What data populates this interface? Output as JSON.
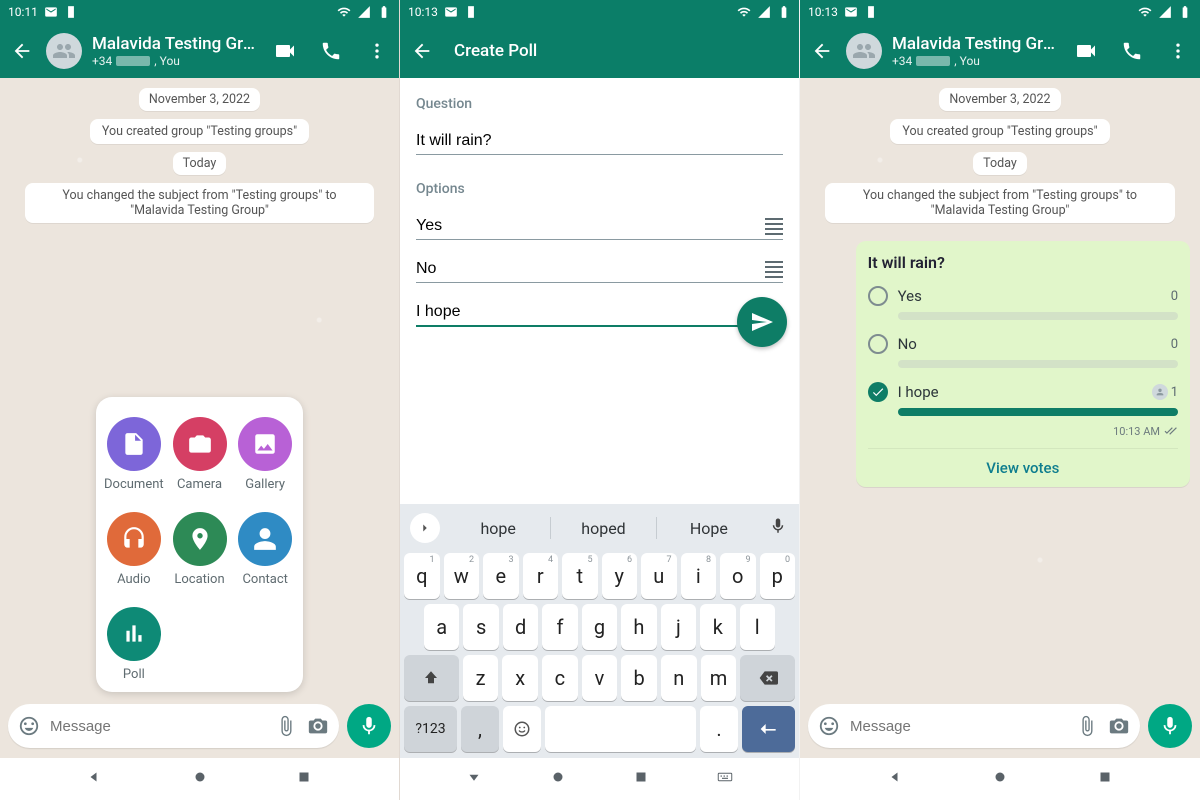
{
  "colors": {
    "teal": "#0b7e68",
    "accent": "#00a884"
  },
  "screens": [
    {
      "time": "10:11",
      "header": {
        "title": "Malavida Testing Group",
        "subtitle_prefix": "+34",
        "subtitle_suffix": ", You"
      },
      "date_pill": "November 3, 2022",
      "system_msg1": "You created group \"Testing groups\"",
      "today_pill": "Today",
      "system_msg2": "You changed the subject from \"Testing groups\" to \"Malavida Testing Group\"",
      "attachments": [
        {
          "label": "Document",
          "color": "#7d66d9",
          "icon": "document"
        },
        {
          "label": "Camera",
          "color": "#d53f64",
          "icon": "camera"
        },
        {
          "label": "Gallery",
          "color": "#b861d6",
          "icon": "image"
        },
        {
          "label": "Audio",
          "color": "#e06a3a",
          "icon": "headphones"
        },
        {
          "label": "Location",
          "color": "#2d8a56",
          "icon": "pin"
        },
        {
          "label": "Contact",
          "color": "#2f8bc4",
          "icon": "person"
        },
        {
          "label": "Poll",
          "color": "#0e8a76",
          "icon": "poll"
        }
      ],
      "input_placeholder": "Message"
    },
    {
      "time": "10:13",
      "title": "Create Poll",
      "question_label": "Question",
      "question_value": "It will rain?",
      "options_label": "Options",
      "options": [
        "Yes",
        "No",
        "I hope"
      ],
      "suggestions": [
        "hope",
        "hoped",
        "Hope"
      ],
      "keyboard_rows": [
        [
          [
            "q",
            "1"
          ],
          [
            "w",
            "2"
          ],
          [
            "e",
            "3"
          ],
          [
            "r",
            "4"
          ],
          [
            "t",
            "5"
          ],
          [
            "y",
            "6"
          ],
          [
            "u",
            "7"
          ],
          [
            "i",
            "8"
          ],
          [
            "o",
            "9"
          ],
          [
            "p",
            "0"
          ]
        ],
        [
          [
            "a",
            ""
          ],
          [
            "s",
            ""
          ],
          [
            "d",
            ""
          ],
          [
            "f",
            ""
          ],
          [
            "g",
            ""
          ],
          [
            "h",
            ""
          ],
          [
            "j",
            ""
          ],
          [
            "k",
            ""
          ],
          [
            "l",
            ""
          ]
        ],
        [
          [
            "z",
            ""
          ],
          [
            "x",
            ""
          ],
          [
            "c",
            ""
          ],
          [
            "v",
            ""
          ],
          [
            "b",
            ""
          ],
          [
            "n",
            ""
          ],
          [
            "m",
            ""
          ]
        ]
      ],
      "fnkey": "?123"
    },
    {
      "time": "10:13",
      "header": {
        "title": "Malavida Testing Group",
        "subtitle_prefix": "+34",
        "subtitle_suffix": ", You"
      },
      "date_pill": "November 3, 2022",
      "system_msg1": "You created group \"Testing groups\"",
      "today_pill": "Today",
      "system_msg2": "You changed the subject from \"Testing groups\" to \"Malavida Testing Group\"",
      "poll": {
        "question": "It will rain?",
        "options": [
          {
            "label": "Yes",
            "count": "0",
            "checked": false,
            "pct": 0
          },
          {
            "label": "No",
            "count": "0",
            "checked": false,
            "pct": 0
          },
          {
            "label": "I hope",
            "count": "1",
            "checked": true,
            "pct": 100
          }
        ],
        "timestamp": "10:13 AM",
        "view_votes": "View votes"
      },
      "input_placeholder": "Message"
    }
  ]
}
